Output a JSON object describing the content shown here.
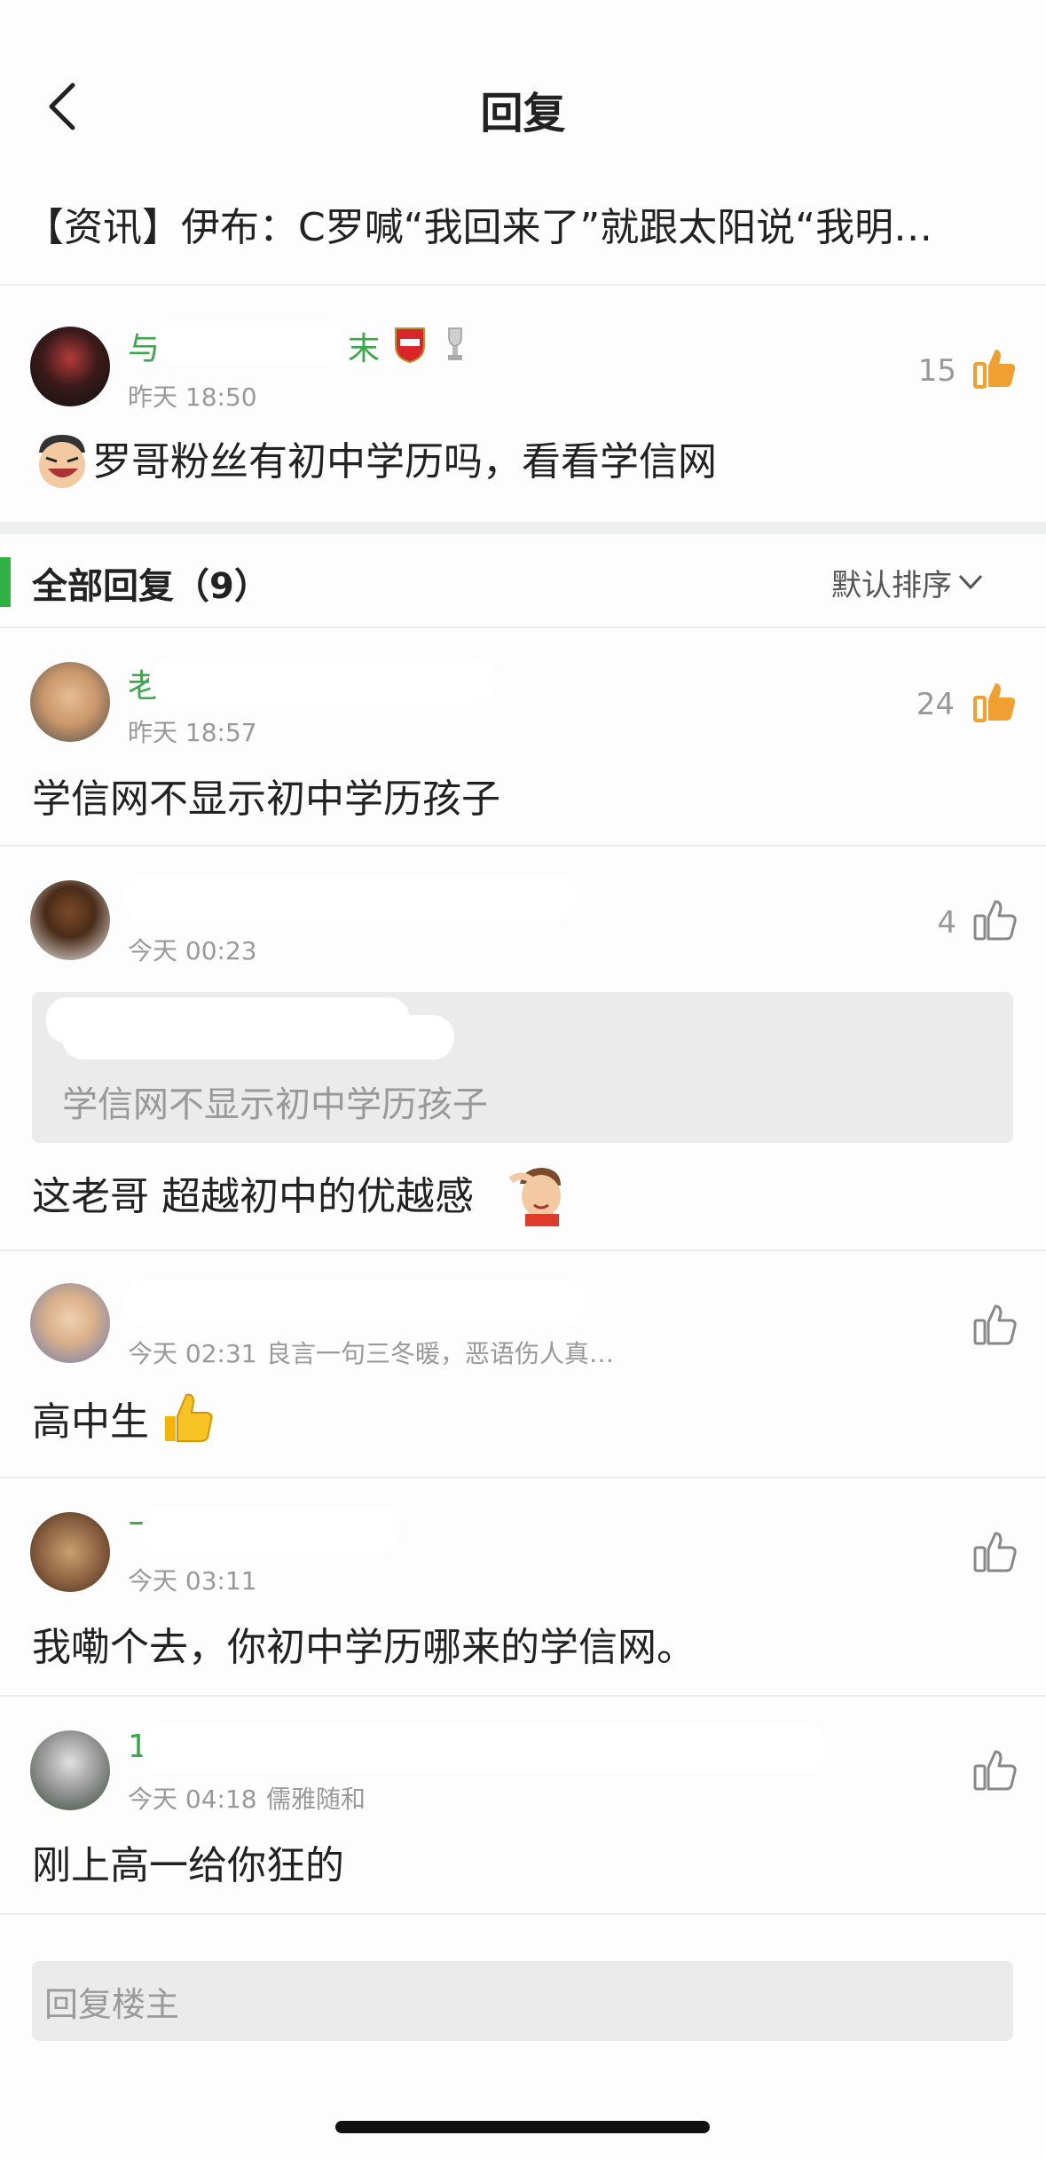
{
  "header": {
    "title": "回复"
  },
  "topic": {
    "title": "【资讯】伊布：C罗喊“我回来了”就跟太阳说“我明…"
  },
  "main_comment": {
    "name_tail": "末",
    "time": "昨天 18:50",
    "likes": "15",
    "text": "罗哥粉丝有初中学历吗，看看学信网"
  },
  "section": {
    "title": "全部回复（9）",
    "sort_label": "默认排序"
  },
  "replies": [
    {
      "time": "昨天 18:57",
      "likes": "24",
      "text": "学信网不显示初中学历孩子",
      "liked": true
    },
    {
      "time": "今天 00:23",
      "likes": "4",
      "quote": "学信网不显示初中学历孩子",
      "text": "这老哥 超越初中的优越感",
      "liked": false
    },
    {
      "time": "今天 02:31",
      "signature": "良言一句三冬暖，恶语伤人真…",
      "likes": "",
      "text": "高中生",
      "liked": false
    },
    {
      "time": "今天 03:11",
      "likes": "",
      "text": "我嘞个去，你初中学历哪来的学信网。",
      "liked": false
    },
    {
      "time": "今天 04:18",
      "signature": "儒雅随和",
      "likes": "",
      "text": "刚上高一给你狂的",
      "liked": false
    }
  ],
  "reply_input": {
    "placeholder": "回复楼主"
  },
  "colors": {
    "accent_green": "#2fb144",
    "like_orange": "#f0a030",
    "text_gray": "#999999"
  }
}
